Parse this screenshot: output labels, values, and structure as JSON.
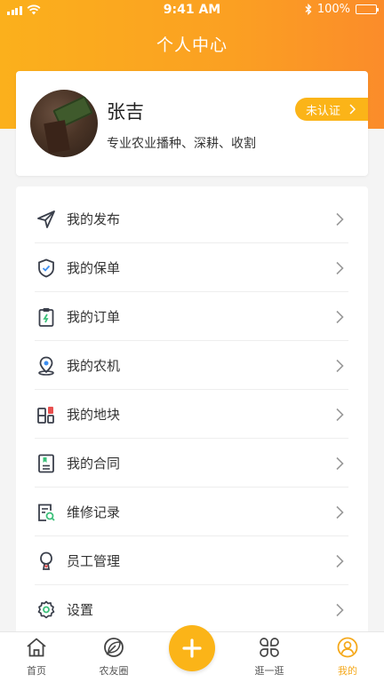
{
  "status_bar": {
    "time": "9:41 AM",
    "battery": "100%"
  },
  "header": {
    "title": "个人中心"
  },
  "profile": {
    "name": "张吉",
    "description": "专业农业播种、深耕、收割",
    "verify_label": "未认证"
  },
  "menu": {
    "items": [
      {
        "label": "我的发布",
        "icon": "send-icon"
      },
      {
        "label": "我的保单",
        "icon": "shield-check-icon"
      },
      {
        "label": "我的订单",
        "icon": "clipboard-icon"
      },
      {
        "label": "我的农机",
        "icon": "location-pin-icon"
      },
      {
        "label": "我的地块",
        "icon": "land-plot-icon"
      },
      {
        "label": "我的合同",
        "icon": "contract-icon"
      },
      {
        "label": "维修记录",
        "icon": "repair-record-icon"
      },
      {
        "label": "员工管理",
        "icon": "staff-icon"
      },
      {
        "label": "设置",
        "icon": "gear-icon"
      }
    ]
  },
  "tabbar": {
    "tabs": [
      {
        "label": "首页",
        "icon": "home-icon"
      },
      {
        "label": "农友圈",
        "icon": "leaf-circle-icon"
      },
      {
        "label": "逛一逛",
        "icon": "browse-icon"
      },
      {
        "label": "我的",
        "icon": "user-icon"
      }
    ],
    "active_index": 3
  },
  "colors": {
    "accent": "#fbb418",
    "header_gradient_start": "#fbb01c",
    "header_gradient_end": "#fb8c2a",
    "icon_dark": "#3a3f4b",
    "icon_green": "#3cc07a",
    "icon_red": "#e8504f"
  }
}
